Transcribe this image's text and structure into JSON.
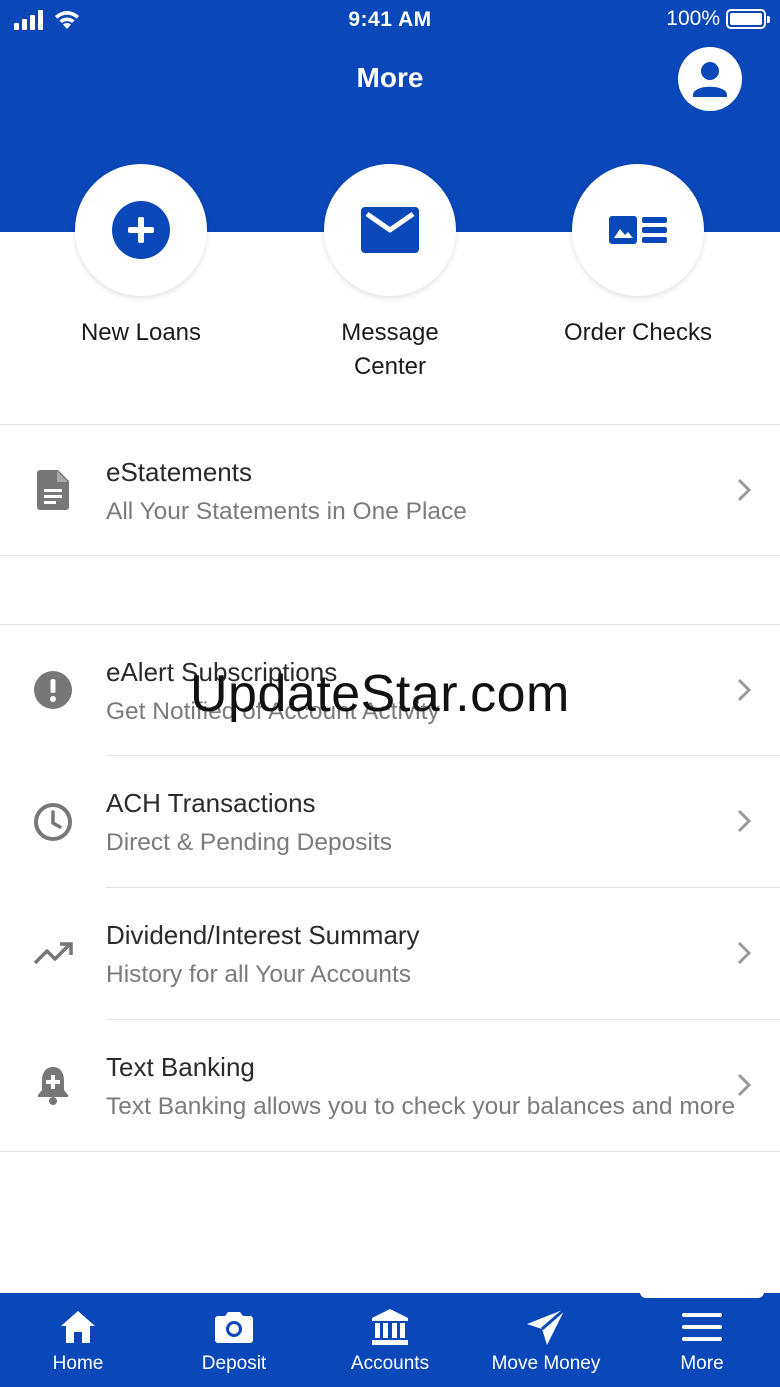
{
  "status_bar": {
    "time": "9:41 AM",
    "battery": "100%"
  },
  "header": {
    "title": "More",
    "profile_icon": "person-icon"
  },
  "quick_actions": [
    {
      "label": "New Loans",
      "icon": "plus-circle-icon"
    },
    {
      "label": "Message\nCenter",
      "icon": "envelope-icon"
    },
    {
      "label": "Order Checks",
      "icon": "check-card-icon"
    }
  ],
  "list": [
    {
      "title": "eStatements",
      "subtitle": "All Your Statements in One Place",
      "icon": "document-icon"
    },
    {
      "title": "eAlert Subscriptions",
      "subtitle": "Get Notified of Account Activity",
      "icon": "alert-circle-icon"
    },
    {
      "title": "ACH Transactions",
      "subtitle": "Direct & Pending Deposits",
      "icon": "clock-icon"
    },
    {
      "title": "Dividend/Interest Summary",
      "subtitle": "History for all Your Accounts",
      "icon": "trending-up-icon"
    },
    {
      "title": "Text Banking",
      "subtitle": "Text Banking allows you to check your balances and more",
      "icon": "bell-plus-icon"
    }
  ],
  "watermark": "UpdateStar.com",
  "tabs": [
    {
      "label": "Home",
      "icon": "home-icon"
    },
    {
      "label": "Deposit",
      "icon": "camera-icon"
    },
    {
      "label": "Accounts",
      "icon": "bank-icon"
    },
    {
      "label": "Move Money",
      "icon": "send-icon"
    },
    {
      "label": "More",
      "icon": "menu-icon",
      "active": true
    }
  ],
  "colors": {
    "brand_blue": "#0a47b9",
    "text_primary": "#2a2a2a",
    "text_secondary": "#7b7b7b",
    "divider": "#e3e3e3"
  }
}
